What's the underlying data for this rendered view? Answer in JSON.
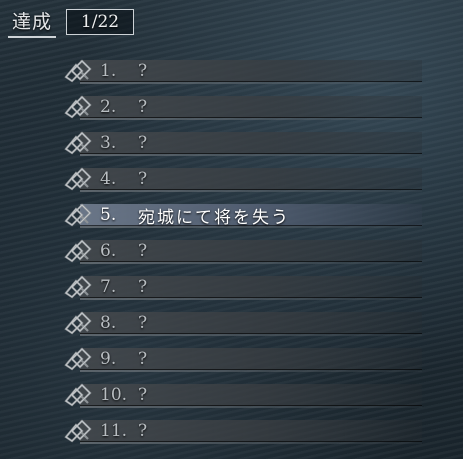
{
  "header": {
    "title": "達成",
    "progress": "1/22"
  },
  "achievements": [
    {
      "number": "1.",
      "label": "?",
      "unlocked": false
    },
    {
      "number": "2.",
      "label": "?",
      "unlocked": false
    },
    {
      "number": "3.",
      "label": "?",
      "unlocked": false
    },
    {
      "number": "4.",
      "label": "?",
      "unlocked": false
    },
    {
      "number": "5.",
      "label": "宛城にて将を失う",
      "unlocked": true
    },
    {
      "number": "6.",
      "label": "?",
      "unlocked": false
    },
    {
      "number": "7.",
      "label": "?",
      "unlocked": false
    },
    {
      "number": "8.",
      "label": "?",
      "unlocked": false
    },
    {
      "number": "9.",
      "label": "?",
      "unlocked": false
    },
    {
      "number": "10.",
      "label": "?",
      "unlocked": false
    },
    {
      "number": "11.",
      "label": "?",
      "unlocked": false
    }
  ],
  "icons": {
    "row_ornament": "knot-icon"
  }
}
